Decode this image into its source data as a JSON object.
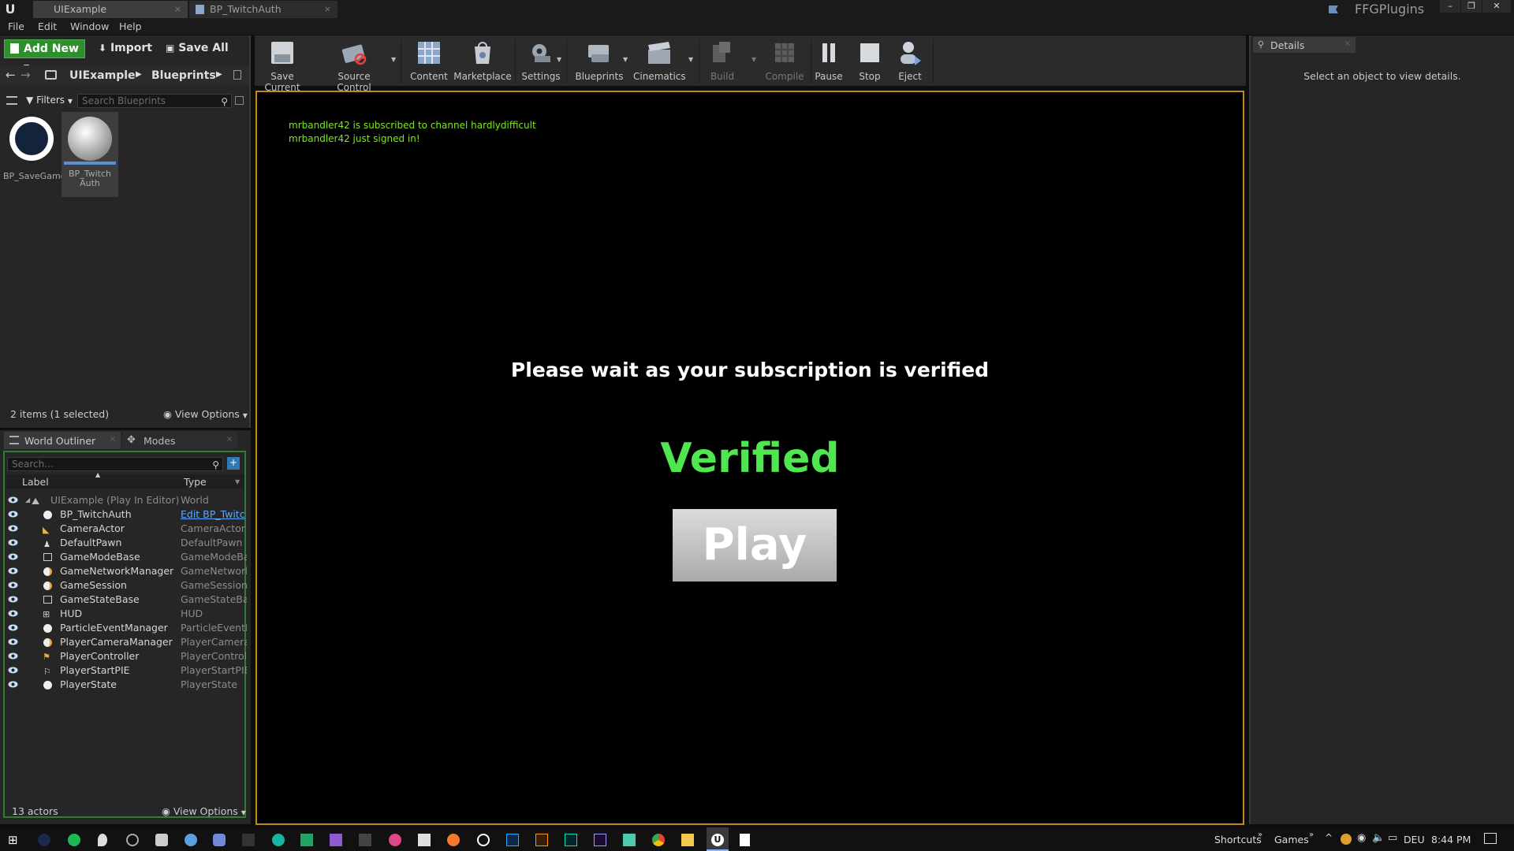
{
  "tabs": [
    {
      "label": "UIExample"
    },
    {
      "label": "BP_TwitchAuth"
    }
  ],
  "project_name": "FFGPlugins",
  "menu": [
    "File",
    "Edit",
    "Window",
    "Help"
  ],
  "content_browser": {
    "add_new": "Add New",
    "import": "Import",
    "save_all": "Save All",
    "path": [
      "UIExample",
      "Blueprints"
    ],
    "filters": "Filters",
    "search_placeholder": "Search Blueprints",
    "assets": [
      {
        "label": "BP_SaveGame"
      },
      {
        "label": "BP_Twitch Auth"
      }
    ],
    "status": "2 items (1 selected)",
    "view_options": "View Options"
  },
  "outliner": {
    "tabs": [
      "World Outliner",
      "Modes"
    ],
    "search_placeholder": "Search...",
    "col_label": "Label",
    "col_type": "Type",
    "rows": [
      {
        "label": "UIExample (Play In Editor)",
        "type": "World"
      },
      {
        "label": "BP_TwitchAuth",
        "type": "Edit BP_Twitc"
      },
      {
        "label": "CameraActor",
        "type": "CameraActor"
      },
      {
        "label": "DefaultPawn",
        "type": "DefaultPawn"
      },
      {
        "label": "GameModeBase",
        "type": "GameModeBas"
      },
      {
        "label": "GameNetworkManager",
        "type": "GameNetworkM"
      },
      {
        "label": "GameSession",
        "type": "GameSession"
      },
      {
        "label": "GameStateBase",
        "type": "GameStateBas"
      },
      {
        "label": "HUD",
        "type": "HUD"
      },
      {
        "label": "ParticleEventManager",
        "type": "ParticleEventM"
      },
      {
        "label": "PlayerCameraManager",
        "type": "PlayerCameraM"
      },
      {
        "label": "PlayerController",
        "type": "PlayerControlle"
      },
      {
        "label": "PlayerStartPIE",
        "type": "PlayerStartPIE"
      },
      {
        "label": "PlayerState",
        "type": "PlayerState"
      }
    ],
    "status": "13 actors",
    "view_options": "View Options"
  },
  "toolbar": [
    {
      "label": "Save Current"
    },
    {
      "label": "Source Control"
    },
    {
      "label": "Content"
    },
    {
      "label": "Marketplace"
    },
    {
      "label": "Settings"
    },
    {
      "label": "Blueprints"
    },
    {
      "label": "Cinematics"
    },
    {
      "label": "Build"
    },
    {
      "label": "Compile"
    },
    {
      "label": "Pause"
    },
    {
      "label": "Stop"
    },
    {
      "label": "Eject"
    }
  ],
  "viewport": {
    "log_lines": [
      "mrbandler42 is subscribed to channel hardlydifficult",
      "mrbandler42 just signed in!"
    ],
    "message": "Please wait as your subscription is verified",
    "status": "Verified",
    "play_button": "Play"
  },
  "details": {
    "tab": "Details",
    "empty_text": "Select an object to view details."
  },
  "taskbar": {
    "shortcuts": "Shortcuts",
    "games": "Games",
    "language": "DEU",
    "time": "8:44 PM"
  },
  "colors": {
    "accent_orange": "#c08a18",
    "verified_green": "#4fe64f",
    "log_green": "#7fe81a",
    "add_new_green": "#2f8f2f"
  }
}
